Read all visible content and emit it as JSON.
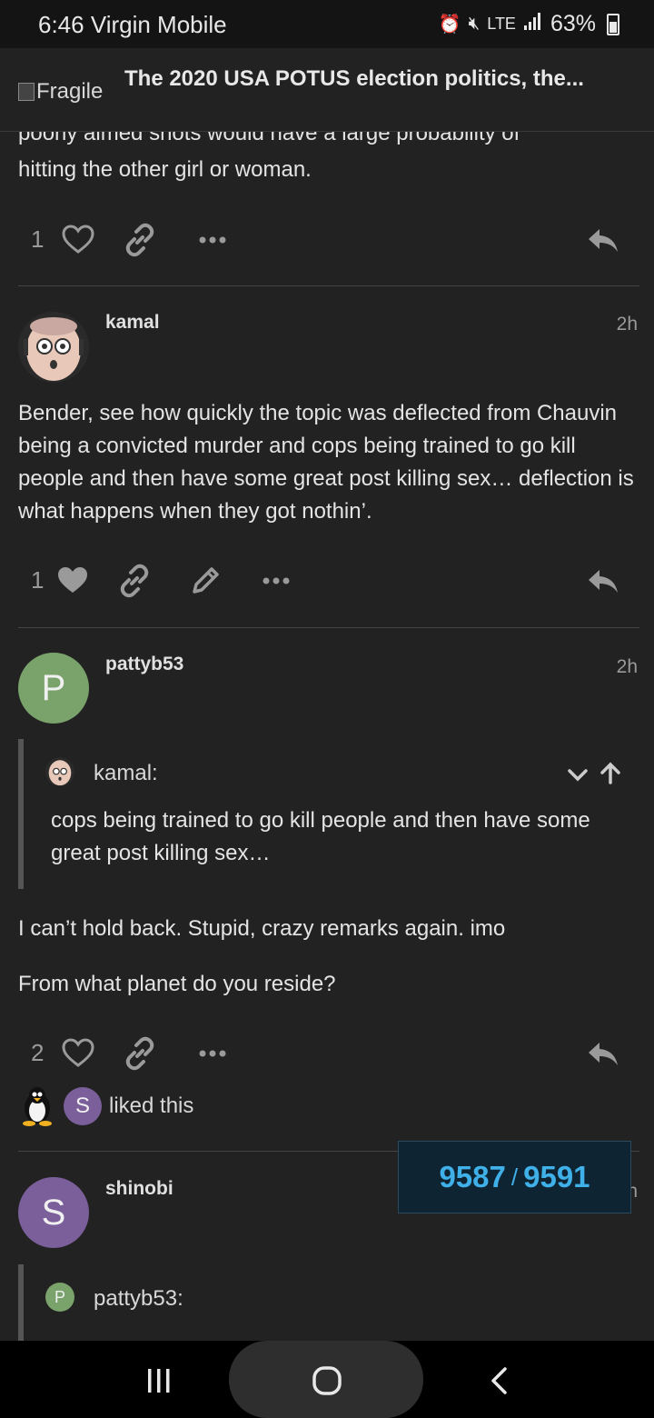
{
  "status_bar": {
    "time_carrier": "6:46 Virgin Mobile",
    "network": "LTE",
    "battery": "63%"
  },
  "header": {
    "logo_alt": "Fragile",
    "title": "The 2020 USA POTUS election politics, the..."
  },
  "posts": [
    {
      "text_partial_line": "poorly aimed shots would have a large probability of",
      "text": "hitting the other girl or woman.",
      "likes": "1"
    },
    {
      "username": "kamal",
      "date": "2h",
      "text": "Bender, see how quickly the topic was deflected from Chauvin being a convicted murder and cops being trained to go kill people and then have some great post killing sex… deflection is what happens when they got nothin’.",
      "likes": "1"
    },
    {
      "username": "pattyb53",
      "avatar_letter": "P",
      "date": "2h",
      "quote_user": "kamal:",
      "quote_text": "cops being trained to go kill people and then have some great post killing sex…",
      "paragraph1": "I can’t hold back. Stupid, crazy remarks again. imo",
      "paragraph2": "From what planet do you reside?",
      "likes": "2",
      "liker_letter": "S",
      "liked_text": "liked this"
    },
    {
      "username": "shinobi",
      "avatar_letter": "S",
      "date": "1h",
      "quote_avatar_letter": "P",
      "quote_user": "pattyb53:"
    }
  ],
  "progress": {
    "current": "9587",
    "separator": "/",
    "total": "9591"
  },
  "colors": {
    "background": "#222222",
    "progress_text": "#3fb0e8",
    "avatar_p": "#7aa26b",
    "avatar_s": "#7a5f9a"
  },
  "icons": [
    "heart-icon",
    "link-icon",
    "more-icon",
    "reply-icon",
    "edit-icon",
    "chevron-down-icon",
    "arrow-up-icon"
  ]
}
